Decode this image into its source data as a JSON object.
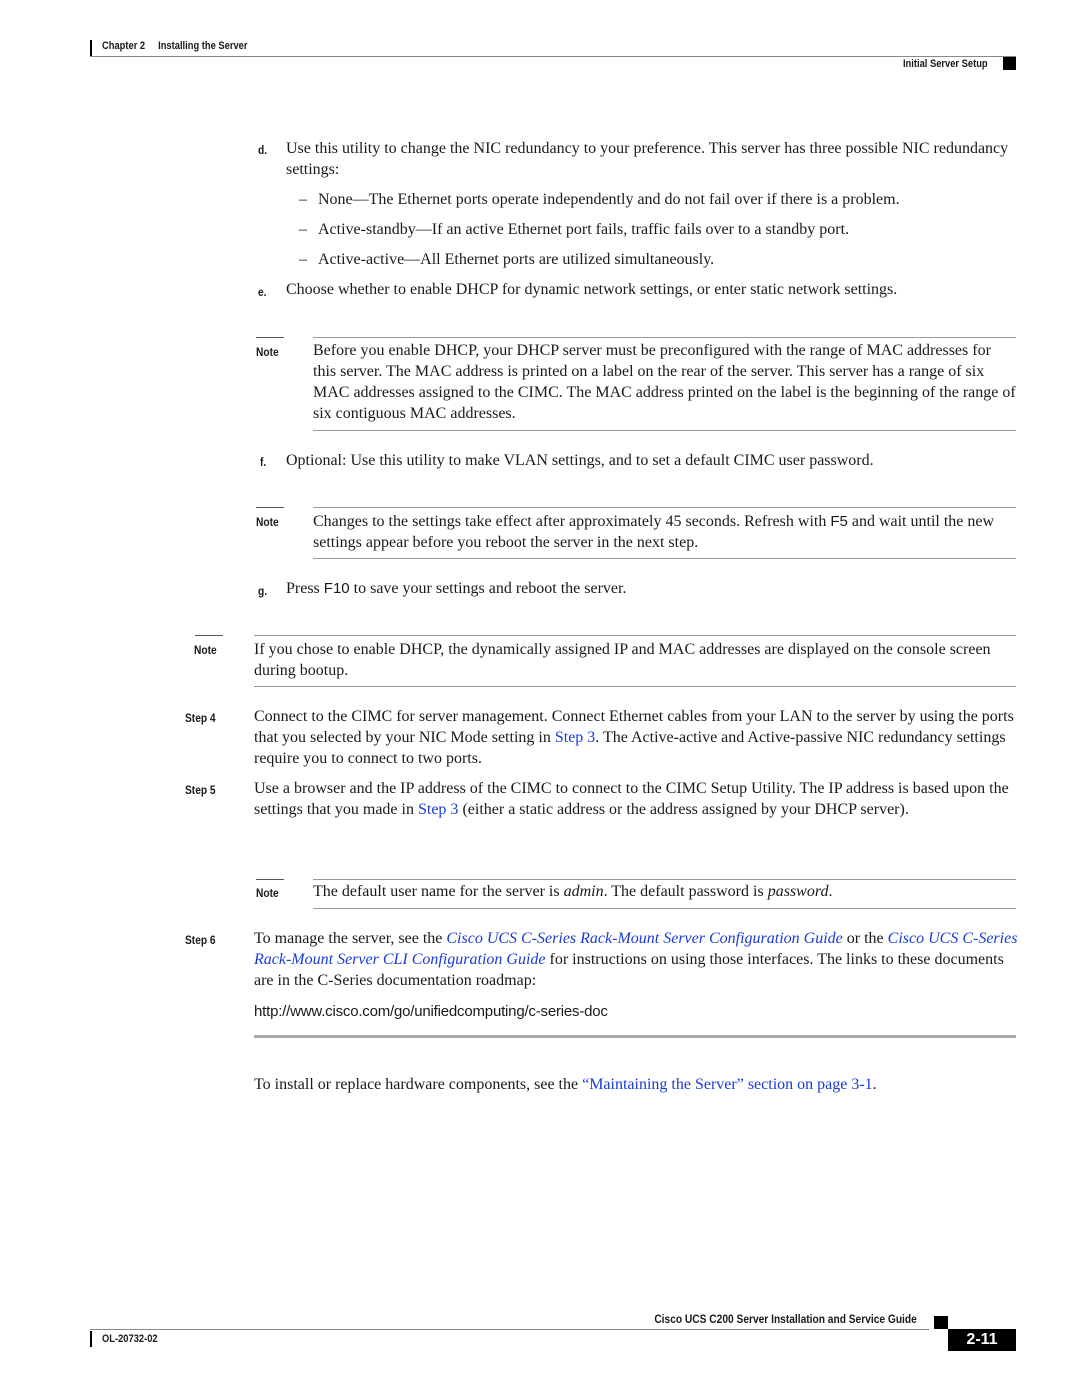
{
  "header": {
    "chapter": "Chapter 2",
    "chapter_title": "Installing the Server",
    "section": "Initial Server Setup"
  },
  "substeps": {
    "d": {
      "label": "d.",
      "text": "Use this utility to change the NIC redundancy to your preference. This server has three possible NIC redundancy settings:",
      "bullets": [
        "None—The Ethernet ports operate independently and do not fail over if there is a problem.",
        "Active-standby—If an active Ethernet port fails, traffic fails over to a standby port.",
        "Active-active—All Ethernet ports are utilized simultaneously."
      ]
    },
    "e": {
      "label": "e.",
      "text": "Choose whether to enable DHCP for dynamic network settings, or enter static network settings."
    },
    "f": {
      "label": "f.",
      "text": "Optional: Use this utility to make VLAN settings, and to set a default CIMC user password."
    },
    "g": {
      "label": "g.",
      "pre": "Press ",
      "key": "F10",
      "post": " to save your settings and reboot the server."
    }
  },
  "notes": {
    "label": "Note",
    "dhcp_preconfig": "Before you enable DHCP, your DHCP server must be preconfigured with the range of MAC addresses for this server. The MAC address is printed on a label on the rear of the server. This server has a range of six MAC addresses assigned to the CIMC. The MAC address printed on the label is the beginning of the range of six contiguous MAC addresses.",
    "settings_delay": {
      "pre": "Changes to the settings take effect after approximately 45 seconds. Refresh with ",
      "key": "F5",
      "post": " and wait until the new settings appear before you reboot the server in the next step."
    },
    "dhcp_display": "If you chose to enable DHCP, the dynamically assigned IP and MAC addresses are displayed on the console screen during bootup.",
    "default_creds": {
      "pre": "The default user name for the server is ",
      "user": "admin",
      "mid": ". The default password is ",
      "password": "password",
      "post": "."
    }
  },
  "steps": {
    "step4": {
      "label": "Step 4",
      "pre": "Connect to the CIMC for server management. Connect Ethernet cables from your LAN to the server by using the ports that you selected by your NIC Mode setting in ",
      "link": "Step 3",
      "post": ". The Active-active and Active-passive NIC redundancy settings require you to connect to two ports."
    },
    "step5": {
      "label": "Step 5",
      "pre": "Use a browser and the IP address of the CIMC to connect to the CIMC Setup Utility. The IP address is based upon the settings that you made in ",
      "link": "Step 3",
      "post": " (either a static address or the address assigned by your DHCP server)."
    },
    "step6": {
      "label": "Step 6",
      "pre": "To manage the server, see the ",
      "link1": "Cisco UCS C-Series Rack-Mount Server Configuration Guide",
      "mid": " or the ",
      "link2": "Cisco UCS C-Series Rack-Mount Server CLI Configuration Guide",
      "post": " for instructions on using those interfaces. The links to these documents are in the C-Series documentation roadmap:",
      "url": "http://www.cisco.com/go/unifiedcomputing/c-series-doc"
    }
  },
  "closing": {
    "pre": "To install or replace hardware components, see the ",
    "link": "“Maintaining the Server” section on page 3-1",
    "post": "."
  },
  "footer": {
    "guide_title": "Cisco UCS C200 Server Installation and Service Guide",
    "doc_id": "OL-20732-02",
    "page_number": "2-11"
  },
  "colors": {
    "link": "#1a3bd6",
    "text": "#1a1a1a"
  }
}
